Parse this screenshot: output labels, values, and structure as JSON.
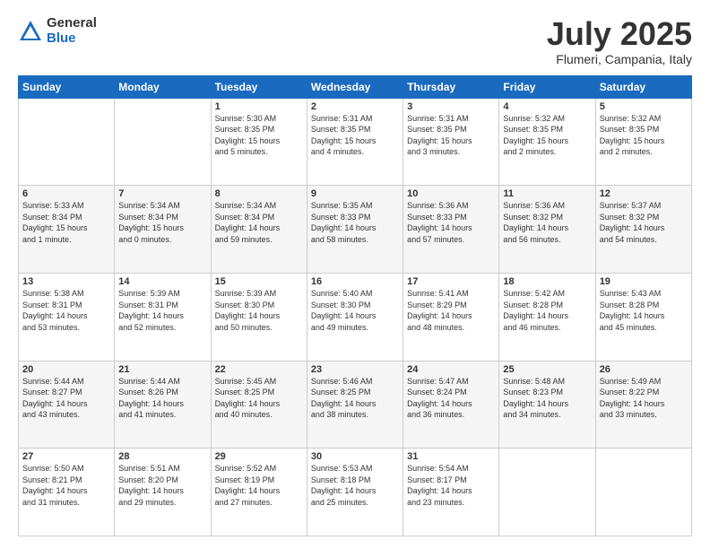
{
  "logo": {
    "general": "General",
    "blue": "Blue"
  },
  "header": {
    "month": "July 2025",
    "location": "Flumeri, Campania, Italy"
  },
  "weekdays": [
    "Sunday",
    "Monday",
    "Tuesday",
    "Wednesday",
    "Thursday",
    "Friday",
    "Saturday"
  ],
  "weeks": [
    [
      {
        "day": "",
        "info": ""
      },
      {
        "day": "",
        "info": ""
      },
      {
        "day": "1",
        "info": "Sunrise: 5:30 AM\nSunset: 8:35 PM\nDaylight: 15 hours\nand 5 minutes."
      },
      {
        "day": "2",
        "info": "Sunrise: 5:31 AM\nSunset: 8:35 PM\nDaylight: 15 hours\nand 4 minutes."
      },
      {
        "day": "3",
        "info": "Sunrise: 5:31 AM\nSunset: 8:35 PM\nDaylight: 15 hours\nand 3 minutes."
      },
      {
        "day": "4",
        "info": "Sunrise: 5:32 AM\nSunset: 8:35 PM\nDaylight: 15 hours\nand 2 minutes."
      },
      {
        "day": "5",
        "info": "Sunrise: 5:32 AM\nSunset: 8:35 PM\nDaylight: 15 hours\nand 2 minutes."
      }
    ],
    [
      {
        "day": "6",
        "info": "Sunrise: 5:33 AM\nSunset: 8:34 PM\nDaylight: 15 hours\nand 1 minute."
      },
      {
        "day": "7",
        "info": "Sunrise: 5:34 AM\nSunset: 8:34 PM\nDaylight: 15 hours\nand 0 minutes."
      },
      {
        "day": "8",
        "info": "Sunrise: 5:34 AM\nSunset: 8:34 PM\nDaylight: 14 hours\nand 59 minutes."
      },
      {
        "day": "9",
        "info": "Sunrise: 5:35 AM\nSunset: 8:33 PM\nDaylight: 14 hours\nand 58 minutes."
      },
      {
        "day": "10",
        "info": "Sunrise: 5:36 AM\nSunset: 8:33 PM\nDaylight: 14 hours\nand 57 minutes."
      },
      {
        "day": "11",
        "info": "Sunrise: 5:36 AM\nSunset: 8:32 PM\nDaylight: 14 hours\nand 56 minutes."
      },
      {
        "day": "12",
        "info": "Sunrise: 5:37 AM\nSunset: 8:32 PM\nDaylight: 14 hours\nand 54 minutes."
      }
    ],
    [
      {
        "day": "13",
        "info": "Sunrise: 5:38 AM\nSunset: 8:31 PM\nDaylight: 14 hours\nand 53 minutes."
      },
      {
        "day": "14",
        "info": "Sunrise: 5:39 AM\nSunset: 8:31 PM\nDaylight: 14 hours\nand 52 minutes."
      },
      {
        "day": "15",
        "info": "Sunrise: 5:39 AM\nSunset: 8:30 PM\nDaylight: 14 hours\nand 50 minutes."
      },
      {
        "day": "16",
        "info": "Sunrise: 5:40 AM\nSunset: 8:30 PM\nDaylight: 14 hours\nand 49 minutes."
      },
      {
        "day": "17",
        "info": "Sunrise: 5:41 AM\nSunset: 8:29 PM\nDaylight: 14 hours\nand 48 minutes."
      },
      {
        "day": "18",
        "info": "Sunrise: 5:42 AM\nSunset: 8:28 PM\nDaylight: 14 hours\nand 46 minutes."
      },
      {
        "day": "19",
        "info": "Sunrise: 5:43 AM\nSunset: 8:28 PM\nDaylight: 14 hours\nand 45 minutes."
      }
    ],
    [
      {
        "day": "20",
        "info": "Sunrise: 5:44 AM\nSunset: 8:27 PM\nDaylight: 14 hours\nand 43 minutes."
      },
      {
        "day": "21",
        "info": "Sunrise: 5:44 AM\nSunset: 8:26 PM\nDaylight: 14 hours\nand 41 minutes."
      },
      {
        "day": "22",
        "info": "Sunrise: 5:45 AM\nSunset: 8:25 PM\nDaylight: 14 hours\nand 40 minutes."
      },
      {
        "day": "23",
        "info": "Sunrise: 5:46 AM\nSunset: 8:25 PM\nDaylight: 14 hours\nand 38 minutes."
      },
      {
        "day": "24",
        "info": "Sunrise: 5:47 AM\nSunset: 8:24 PM\nDaylight: 14 hours\nand 36 minutes."
      },
      {
        "day": "25",
        "info": "Sunrise: 5:48 AM\nSunset: 8:23 PM\nDaylight: 14 hours\nand 34 minutes."
      },
      {
        "day": "26",
        "info": "Sunrise: 5:49 AM\nSunset: 8:22 PM\nDaylight: 14 hours\nand 33 minutes."
      }
    ],
    [
      {
        "day": "27",
        "info": "Sunrise: 5:50 AM\nSunset: 8:21 PM\nDaylight: 14 hours\nand 31 minutes."
      },
      {
        "day": "28",
        "info": "Sunrise: 5:51 AM\nSunset: 8:20 PM\nDaylight: 14 hours\nand 29 minutes."
      },
      {
        "day": "29",
        "info": "Sunrise: 5:52 AM\nSunset: 8:19 PM\nDaylight: 14 hours\nand 27 minutes."
      },
      {
        "day": "30",
        "info": "Sunrise: 5:53 AM\nSunset: 8:18 PM\nDaylight: 14 hours\nand 25 minutes."
      },
      {
        "day": "31",
        "info": "Sunrise: 5:54 AM\nSunset: 8:17 PM\nDaylight: 14 hours\nand 23 minutes."
      },
      {
        "day": "",
        "info": ""
      },
      {
        "day": "",
        "info": ""
      }
    ]
  ]
}
